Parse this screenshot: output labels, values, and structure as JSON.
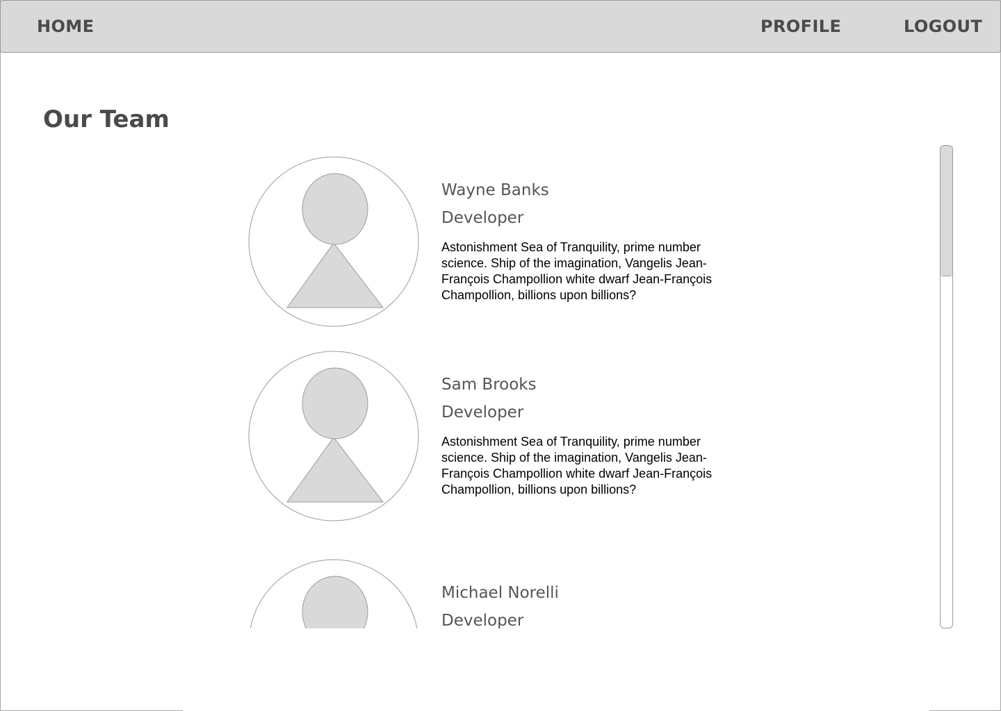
{
  "nav": {
    "home_label": "HOME",
    "profile_label": "PROFILE",
    "logout_label": "LOGOUT"
  },
  "page": {
    "title": "Our Team"
  },
  "team": [
    {
      "name": "Wayne Banks",
      "role": "Developer",
      "bio": "Astonishment Sea of Tranquility, prime number science. Ship of the imagination, Vangelis Jean-François Champollion white dwarf Jean-François Champollion, billions upon billions?",
      "avatar_icon": "user-placeholder-icon"
    },
    {
      "name": "Sam Brooks",
      "role": "Developer",
      "bio": "Astonishment Sea of Tranquility, prime number science. Ship of the imagination, Vangelis Jean-François Champollion white dwarf Jean-François Champollion, billions upon billions?",
      "avatar_icon": "user-placeholder-icon"
    },
    {
      "name": "Michael Norelli",
      "role": "Developer",
      "avatar_icon": "user-placeholder-icon"
    }
  ],
  "scroll": {
    "position_fraction": 0,
    "visible_fraction": 0.27
  },
  "colors": {
    "nav_background": "#d9d9d9",
    "placeholder_fill": "#d9d9d9",
    "heading_text": "#4a4a4a",
    "body_text": "#000000"
  }
}
